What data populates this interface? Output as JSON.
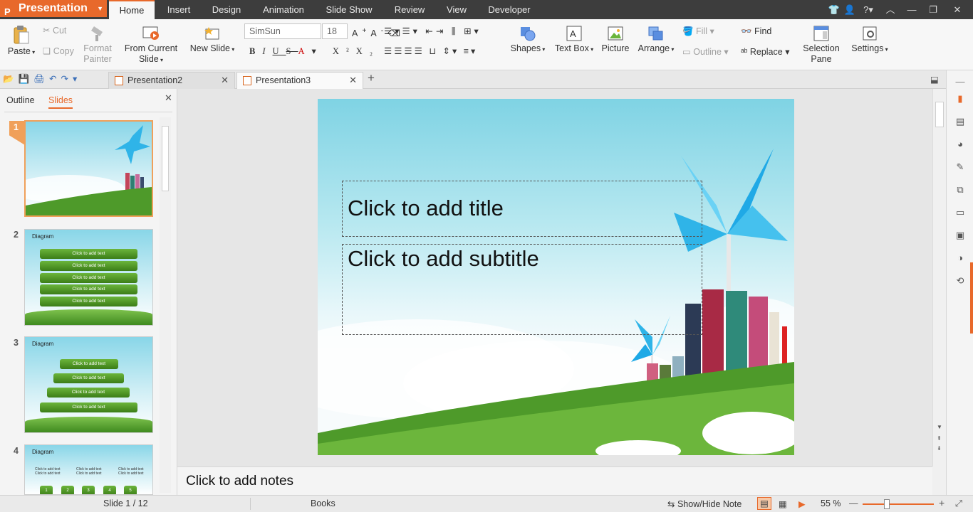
{
  "app": {
    "name": "Presentation"
  },
  "menu": {
    "tabs": [
      "Home",
      "Insert",
      "Design",
      "Animation",
      "Slide Show",
      "Review",
      "View",
      "Developer"
    ],
    "active": "Home"
  },
  "ribbon": {
    "paste": "Paste",
    "cut": "Cut",
    "copy": "Copy",
    "format_painter": [
      "Format",
      "Painter"
    ],
    "from_current_slide": [
      "From Current",
      "Slide"
    ],
    "new_slide": "New Slide",
    "font_name": "SimSun",
    "font_size": "18",
    "shapes": "Shapes",
    "text_box": "Text Box",
    "picture": "Picture",
    "arrange": "Arrange",
    "fill": "Fill",
    "outline": "Outline",
    "find": "Find",
    "replace": "Replace",
    "selection_pane": [
      "Selection",
      "Pane"
    ],
    "settings": "Settings"
  },
  "doc_tabs": [
    {
      "label": "Presentation2"
    },
    {
      "label": "Presentation3"
    }
  ],
  "panel": {
    "tabs": [
      "Outline",
      "Slides"
    ],
    "active": "Slides"
  },
  "thumbnails": [
    {
      "num": "1",
      "type": "title"
    },
    {
      "num": "2",
      "title": "Diagram",
      "bars": [
        "Click to add text",
        "Click to add text",
        "Click to add text",
        "Click to add text",
        "Click to add text"
      ]
    },
    {
      "num": "3",
      "title": "Diagram",
      "bars": [
        "Click to add text",
        "Click to add text",
        "Click to add text",
        "Click to add text"
      ]
    },
    {
      "num": "4",
      "title": "Diagram",
      "cols": [
        "Click to add text\nClick to add text",
        "Click to add text\nClick to add text",
        "Click to add text\nClick to add text"
      ],
      "nums": [
        "1",
        "2",
        "3",
        "4",
        "5"
      ]
    }
  ],
  "slide": {
    "title_placeholder": "Click to add title",
    "subtitle_placeholder": "Click to add subtitle"
  },
  "notes": {
    "placeholder": "Click to add notes"
  },
  "status": {
    "slide": "Slide 1 / 12",
    "theme": "Books",
    "show_hide_note": "Show/Hide Note",
    "zoom": "55 %"
  },
  "colors": {
    "accent": "#e8692b",
    "titlebar": "#3d3d3d"
  }
}
